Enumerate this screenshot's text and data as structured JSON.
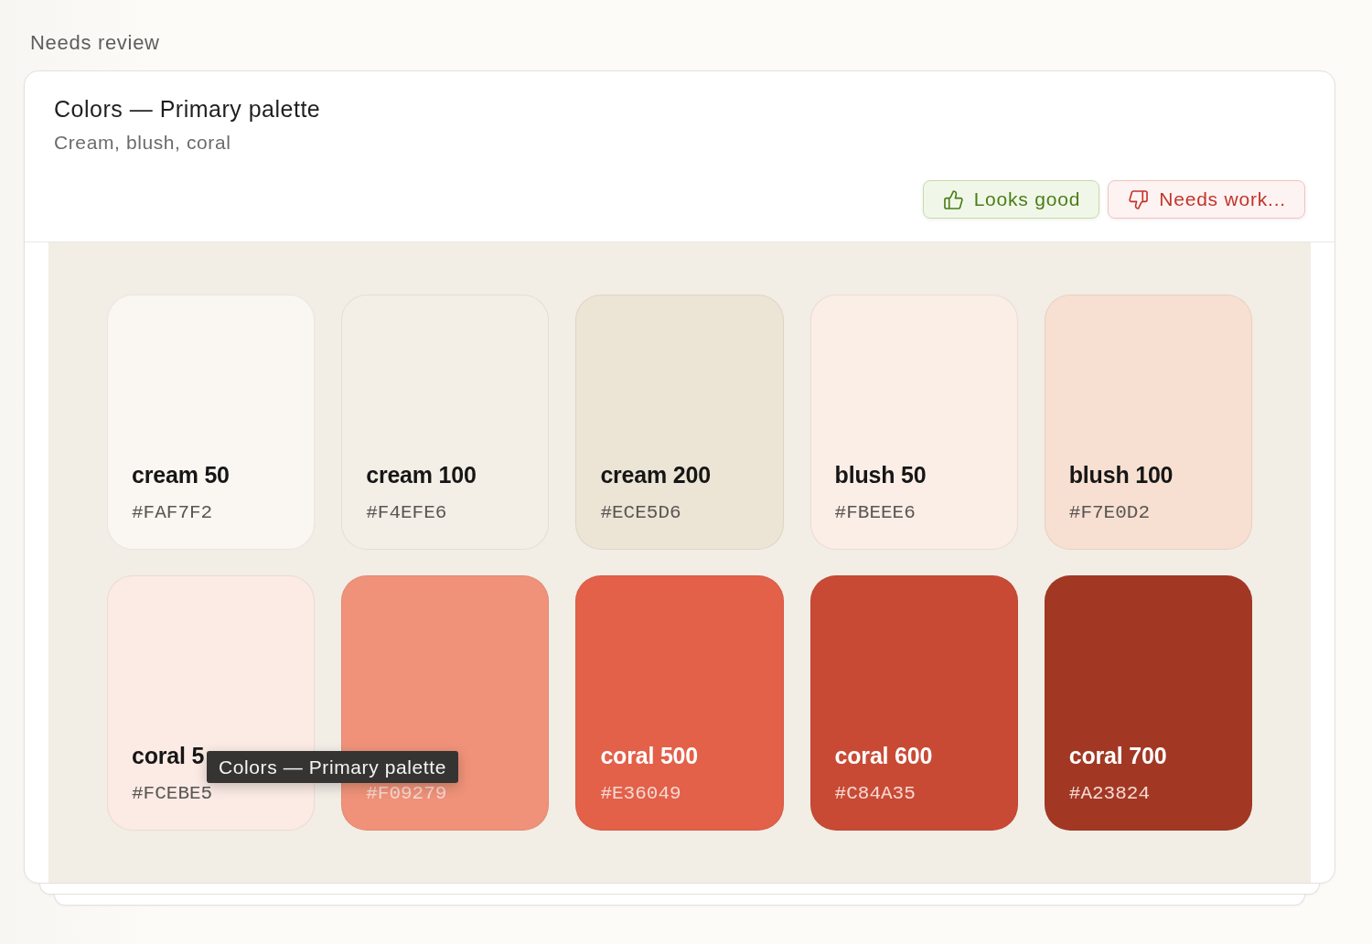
{
  "section_label": "Needs review",
  "card": {
    "title": "Colors — Primary palette",
    "subtitle": "Cream, blush, coral",
    "actions": [
      {
        "kind": "approve",
        "label": "Looks good"
      },
      {
        "kind": "reject",
        "label": "Needs work..."
      }
    ],
    "swatches": [
      {
        "name": "cream 50",
        "hex": "#FAF7F2",
        "color": "#faf7f2"
      },
      {
        "name": "cream 100",
        "hex": "#F4EFE6",
        "color": "#f4efe6"
      },
      {
        "name": "cream 200",
        "hex": "#ECE5D6",
        "color": "#ece5d6"
      },
      {
        "name": "blush 50",
        "hex": "#FBEEE6",
        "color": "#fbeee6"
      },
      {
        "name": "blush 100",
        "hex": "#F7E0D2",
        "color": "#f7e0d2"
      },
      {
        "name": "coral 5",
        "hex": "#FCEBE5",
        "color": "#fcebe5"
      },
      {
        "hex": "#F09279",
        "color": "#f09279"
      },
      {
        "name": "coral 500",
        "hex": "#E36049",
        "color": "#e36049"
      },
      {
        "name": "coral 600",
        "hex": "#C84A35",
        "color": "#c84a35"
      },
      {
        "name": "coral 700",
        "hex": "#A23824",
        "color": "#a23824"
      }
    ],
    "tooltip": {
      "text": "Colors — Primary palette"
    }
  }
}
